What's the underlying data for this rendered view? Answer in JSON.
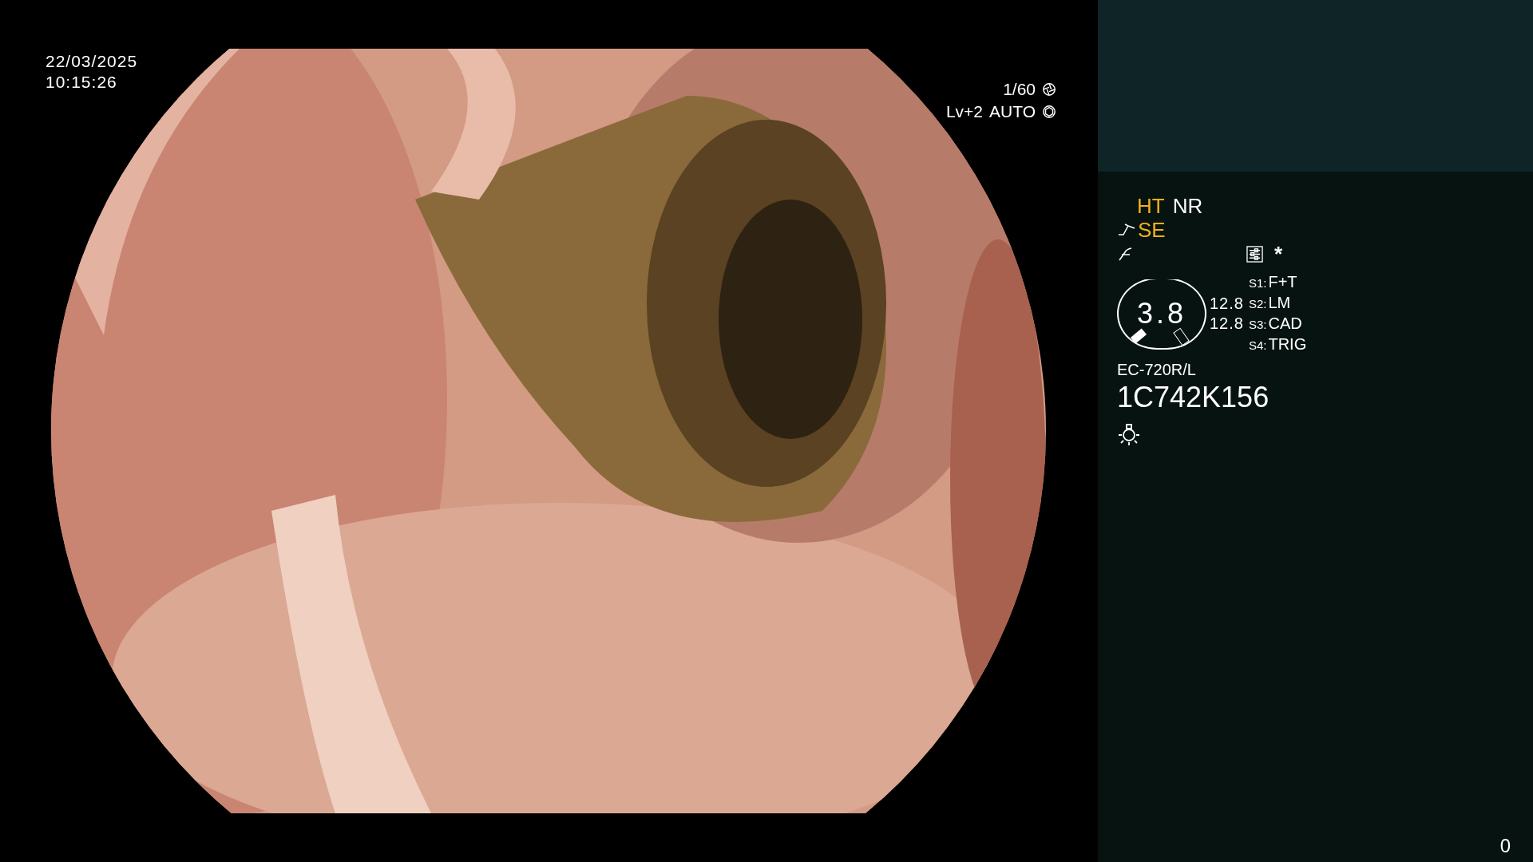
{
  "overlay": {
    "date": "22/03/2025",
    "time": "10:15:26",
    "shutter": "1/60",
    "level": "Lv+2",
    "mode": "AUTO"
  },
  "modes": [
    {
      "label": "HT",
      "on": true
    },
    {
      "label": "NR",
      "on": false
    }
  ],
  "enhance": {
    "label": "SE",
    "on": true
  },
  "gauge": {
    "value": "3.8",
    "readings": [
      "12.8",
      "12.8"
    ]
  },
  "switches": [
    {
      "key": "S1:",
      "label": "F+T"
    },
    {
      "key": "S2:",
      "label": "LM"
    },
    {
      "key": "S3:",
      "label": "CAD"
    },
    {
      "key": "S4:",
      "label": "TRIG"
    }
  ],
  "asterisk": "*",
  "scope": {
    "model": "EC-720R/L",
    "serial": "1C742K156"
  },
  "counter": "0"
}
